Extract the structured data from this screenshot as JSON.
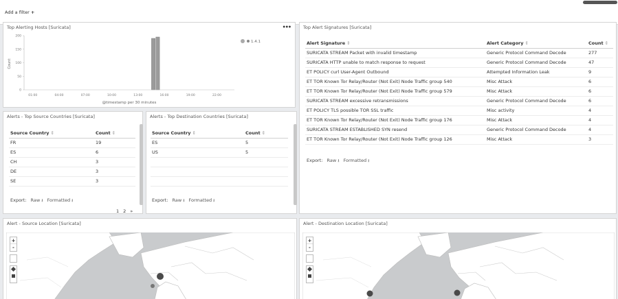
{
  "filter_bar": {
    "add_filter_label": "Add a filter",
    "plus_icon": "+"
  },
  "panels": {
    "hosts": {
      "title": "Top Alerting Hosts [Suricata]",
      "menu": "•••",
      "legend": "1.4.1",
      "xlabel": "@timestamp per 30 minutes",
      "ylabel": "Count"
    },
    "signatures": {
      "title": "Top Alert Signatures [Suricata]",
      "headers": {
        "sig": "Alert Signature",
        "cat": "Alert Category",
        "count": "Count"
      },
      "rows": [
        {
          "sig": "SURICATA STREAM Packet with invalid timestamp",
          "cat": "Generic Protocol Command Decode",
          "count": "277"
        },
        {
          "sig": "SURICATA HTTP unable to match response to request",
          "cat": "Generic Protocol Command Decode",
          "count": "47"
        },
        {
          "sig": "ET POLICY curl User-Agent Outbound",
          "cat": "Attempted Information Leak",
          "count": "9"
        },
        {
          "sig": "ET TOR Known Tor Relay/Router (Not Exit) Node Traffic group 540",
          "cat": "Misc Attack",
          "count": "6"
        },
        {
          "sig": "ET TOR Known Tor Relay/Router (Not Exit) Node Traffic group 579",
          "cat": "Misc Attack",
          "count": "6"
        },
        {
          "sig": "SURICATA STREAM excessive retransmissions",
          "cat": "Generic Protocol Command Decode",
          "count": "6"
        },
        {
          "sig": "ET POLICY TLS possible TOR SSL traffic",
          "cat": "Misc activity",
          "count": "4"
        },
        {
          "sig": "ET TOR Known Tor Relay/Router (Not Exit) Node Traffic group 176",
          "cat": "Misc Attack",
          "count": "4"
        },
        {
          "sig": "SURICATA STREAM ESTABLISHED SYN resend",
          "cat": "Generic Protocol Command Decode",
          "count": "4"
        },
        {
          "sig": "ET TOR Known Tor Relay/Router (Not Exit) Node Traffic group 126",
          "cat": "Misc Attack",
          "count": "3"
        }
      ],
      "export_label": "Export:",
      "raw_label": "Raw",
      "formatted_label": "Formatted"
    },
    "src_countries": {
      "title": "Alerts - Top Source Countries [Suricata]",
      "headers": {
        "country": "Source Country",
        "count": "Count"
      },
      "rows": [
        {
          "country": "FR",
          "count": "19"
        },
        {
          "country": "ES",
          "count": "6"
        },
        {
          "country": "CH",
          "count": "3"
        },
        {
          "country": "DE",
          "count": "3"
        },
        {
          "country": "SE",
          "count": "3"
        }
      ],
      "export_label": "Export:",
      "raw_label": "Raw",
      "formatted_label": "Formatted",
      "pages": [
        "1",
        "2",
        "»"
      ]
    },
    "dst_countries": {
      "title": "Alerts - Top Destination Countries [Suricata]",
      "headers": {
        "country": "Source Country",
        "count": "Count"
      },
      "rows": [
        {
          "country": "ES",
          "count": "5"
        },
        {
          "country": "US",
          "count": "5"
        }
      ],
      "export_label": "Export:",
      "raw_label": "Raw",
      "formatted_label": "Formatted"
    },
    "src_location": {
      "title": "Alert - Source Location [Suricata]"
    },
    "dst_location": {
      "title": "Alert - Destination Location [Suricata]"
    }
  },
  "map_controls": {
    "zoom_in": "+",
    "zoom_out": "-"
  },
  "chart_data": {
    "type": "bar",
    "ylabel": "Count",
    "xlabel": "@timestamp per 30 minutes",
    "y_ticks": [
      0,
      50,
      100,
      150,
      200
    ],
    "ylim": [
      0,
      200
    ],
    "x_ticks": [
      "01:00",
      "04:00",
      "07:00",
      "10:00",
      "13:00",
      "16:00",
      "19:00",
      "22:00"
    ],
    "categories": [
      "14:30",
      "15:00"
    ],
    "series": [
      {
        "name": "1.4.1",
        "values": [
          190,
          195
        ]
      }
    ],
    "grid": false,
    "legend": "top-right"
  }
}
